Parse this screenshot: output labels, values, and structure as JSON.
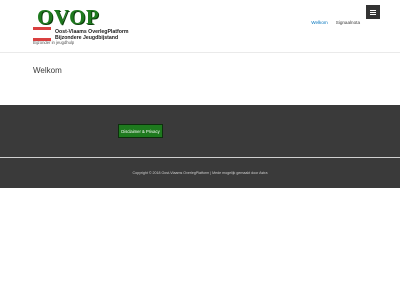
{
  "header": {
    "logo": {
      "main": "OVOP",
      "line1": "Oost-Vlaams OverlegPlatform",
      "line2": "Bijzondere Jeugdbijstand"
    },
    "tagline": "Bijzonder in jeugdhulp",
    "nav": [
      {
        "label": "Welkom",
        "active": true
      },
      {
        "label": "Signaalnota",
        "active": false
      }
    ],
    "menu_icon": "hamburger-icon"
  },
  "content": {
    "title": "Welkom"
  },
  "footer": {
    "button_label": "Disclaimer & Privacy",
    "copyright": "Copyright © 2018 Oost-Vlaams OverlegPlatform | Mede mogelijk gemaakt door Astra"
  },
  "colors": {
    "brand_green": "#1e7a1e",
    "logo_red": "#d94040",
    "nav_active": "#0274be",
    "footer_bg": "#3a3a3a"
  }
}
